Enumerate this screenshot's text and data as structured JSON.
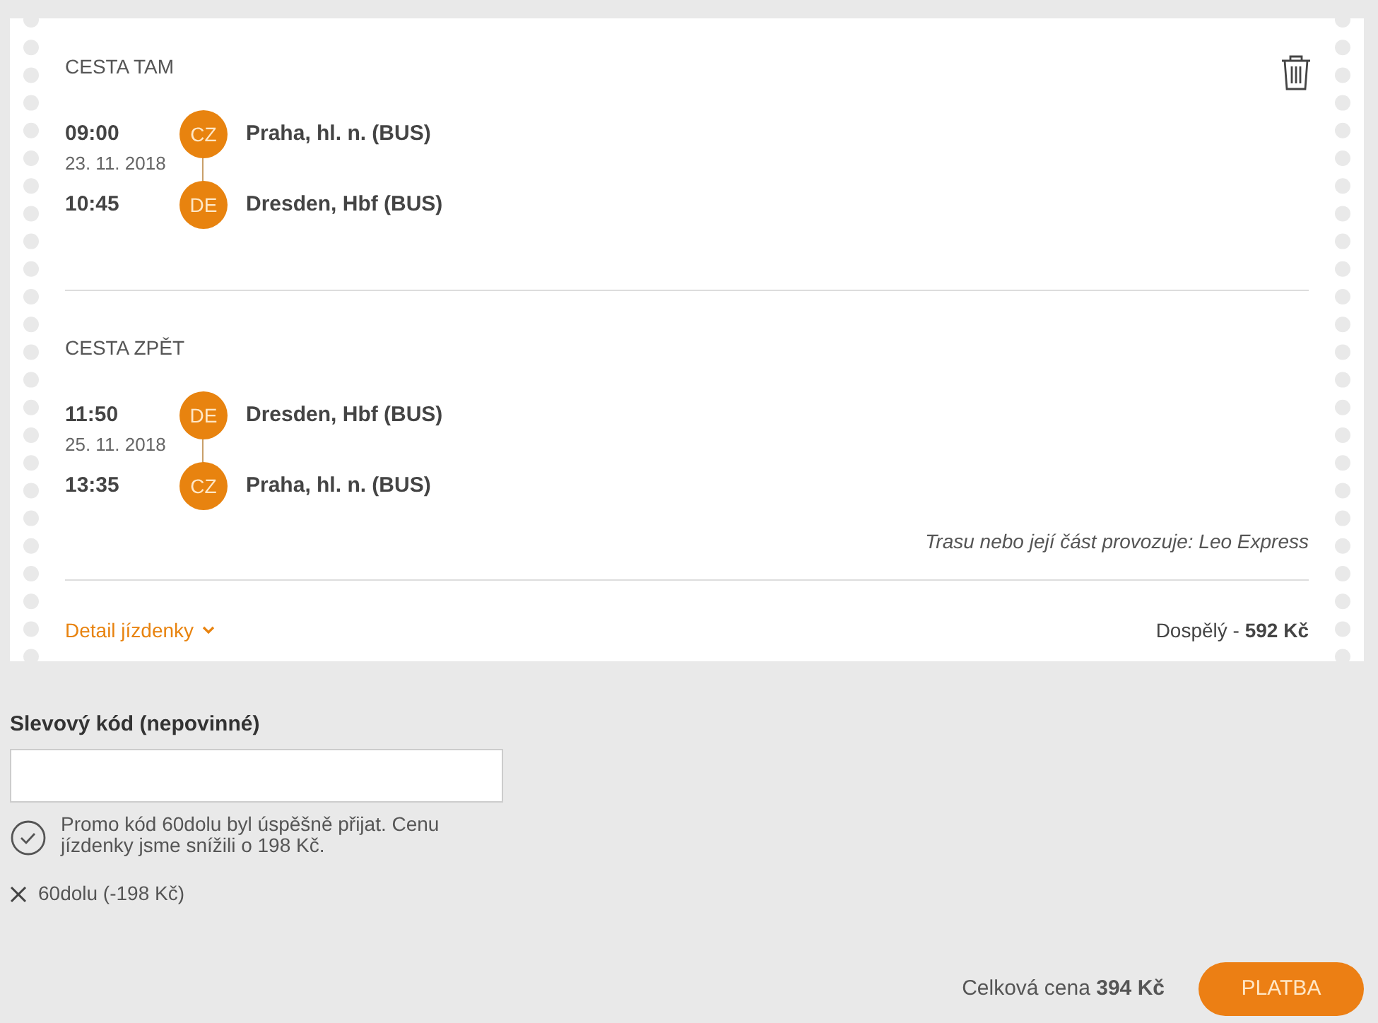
{
  "ticket": {
    "trips": [
      {
        "title": "CESTA TAM",
        "segments": [
          {
            "time": "09:00",
            "date": "23. 11. 2018",
            "code": "CZ",
            "station": "Praha, hl. n. (BUS)"
          },
          {
            "time": "10:45",
            "code": "DE",
            "station": "Dresden, Hbf (BUS)"
          }
        ]
      },
      {
        "title": "CESTA ZPĚT",
        "segments": [
          {
            "time": "11:50",
            "date": "25. 11. 2018",
            "code": "DE",
            "station": "Dresden, Hbf (BUS)"
          },
          {
            "time": "13:35",
            "code": "CZ",
            "station": "Praha, hl. n. (BUS)"
          }
        ],
        "operator_note": "Trasu nebo její část provozuje: Leo Express"
      }
    ],
    "detail_link": "Detail jízdenky",
    "fare": "Dospělý - **592 Kč**"
  },
  "promo": {
    "label": "Slevový kód (nepovinné)",
    "message": "Promo kód 60dolu byl úspěšně přijat. Cenu jízdenky jsme snížili o 198 Kč.",
    "applied_code": "60dolu (-198 Kč)"
  },
  "total": "Celková cena **394 Kč**",
  "pay_button": "PLATBA"
}
